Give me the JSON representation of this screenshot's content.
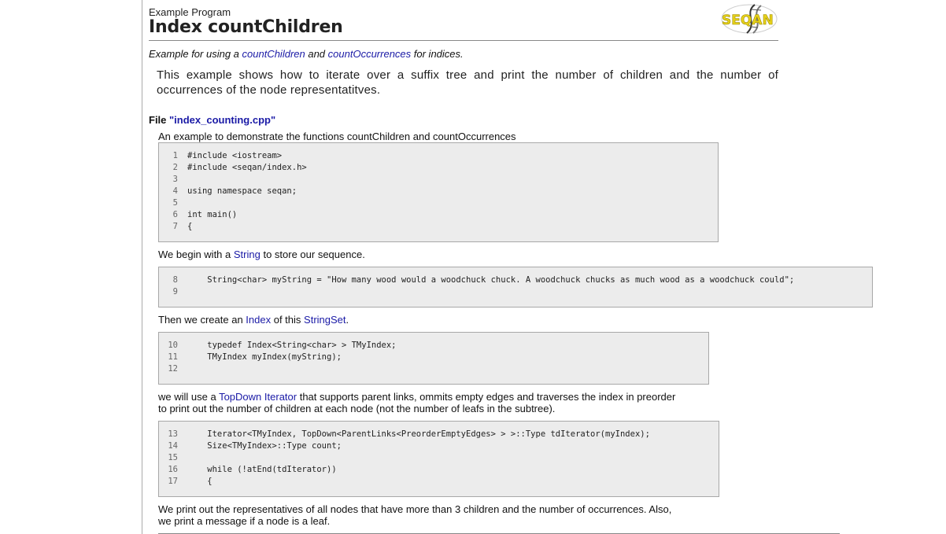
{
  "header": {
    "kicker": "Example Program",
    "title": "Index countChildren",
    "logo_text": "SEQAN"
  },
  "subtitle": {
    "prefix": "Example for using a ",
    "link1": "countChildren",
    "middle": " and ",
    "link2": "countOccurrences",
    "suffix": " for indices."
  },
  "intro": "This example shows how to iterate over a suffix tree and print the number of children and the number of occurrences of the node representatitves.",
  "file": {
    "label": "File ",
    "name": "\"index_counting.cpp\""
  },
  "sections": {
    "s1": {
      "text": "An example to demonstrate the functions countChildren and countOccurrences"
    },
    "s2": {
      "pre": "We begin with a ",
      "link": "String",
      "post": " to store our sequence."
    },
    "s3": {
      "pre": "Then we create an ",
      "link1": "Index",
      "mid": " of this ",
      "link2": "StringSet",
      "post": "."
    },
    "s4": {
      "pre": "we will use a ",
      "link1": "TopDown",
      "mid": " ",
      "link2": "Iterator",
      "post": " that supports parent links, ommits empty edges and traverses the index in preorder",
      "line2": "to print out the number of children at each node (not the number of leafs in the subtree)."
    },
    "s5": {
      "line1": "We print out the representatives of all nodes that have more than 3 children and the number of occurrences. Also,",
      "line2": "we print a message if a node is a leaf."
    }
  },
  "code": {
    "block1": [
      {
        "n": "1",
        "src": "#include <iostream>"
      },
      {
        "n": "2",
        "src": "#include <seqan/index.h>"
      },
      {
        "n": "3",
        "src": ""
      },
      {
        "n": "4",
        "src": "using namespace seqan;"
      },
      {
        "n": "5",
        "src": ""
      },
      {
        "n": "6",
        "src": "int main()"
      },
      {
        "n": "7",
        "src": "{"
      }
    ],
    "block2": [
      {
        "n": "8",
        "src": "    String<char> myString = \"How many wood would a woodchuck chuck. A woodchuck chucks as much wood as a woodchuck could\";"
      },
      {
        "n": "9",
        "src": ""
      }
    ],
    "block3": [
      {
        "n": "10",
        "src": "    typedef Index<String<char> > TMyIndex;"
      },
      {
        "n": "11",
        "src": "    TMyIndex myIndex(myString);"
      },
      {
        "n": "12",
        "src": ""
      }
    ],
    "block4": [
      {
        "n": "13",
        "src": "    Iterator<TMyIndex, TopDown<ParentLinks<PreorderEmptyEdges> > >::Type tdIterator(myIndex);"
      },
      {
        "n": "14",
        "src": "    Size<TMyIndex>::Type count;"
      },
      {
        "n": "15",
        "src": ""
      },
      {
        "n": "16",
        "src": "    while (!atEnd(tdIterator))"
      },
      {
        "n": "17",
        "src": "    {"
      }
    ]
  },
  "colors": {
    "link": "#1a1aa6",
    "code_bg": "#ececec",
    "logo_yellow": "#e8d21a"
  }
}
